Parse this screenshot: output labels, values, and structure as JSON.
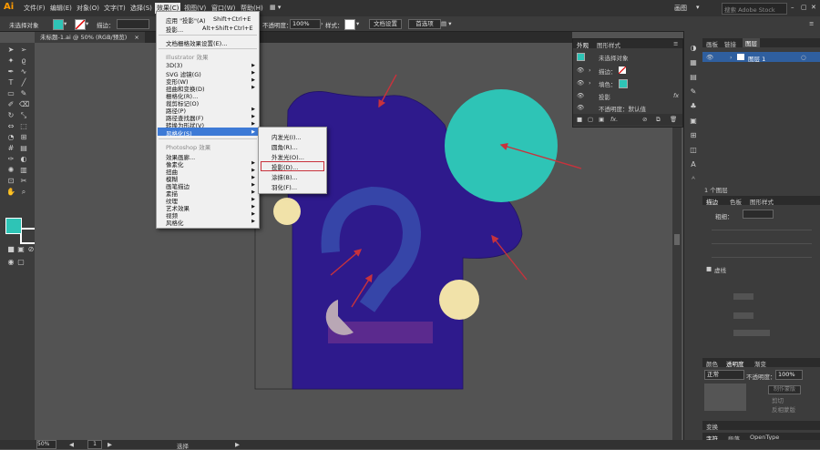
{
  "menubar": {
    "logo": "Ai",
    "items": [
      "文件(F)",
      "编辑(E)",
      "对象(O)",
      "文字(T)",
      "选择(S)",
      "效果(C)",
      "视图(V)",
      "窗口(W)",
      "帮助(H)"
    ],
    "active_index": 5,
    "workspace": "画图",
    "search_placeholder": "搜索 Adobe Stock"
  },
  "control_bar": {
    "selection": "未选择对象",
    "stroke_label": "描边：",
    "opacity_label": "不透明度：",
    "opacity_value": "100%",
    "style_label": "样式：",
    "doc_setup": "文档设置",
    "prefs": "首选项"
  },
  "document_tab": {
    "label": "未标题-1.ai @ 50% (RGB/预览)",
    "close": "×"
  },
  "effect_menu": {
    "items": [
      {
        "label": "应用 \"投影\"(A)",
        "shortcut": "Shift+Ctrl+E"
      },
      {
        "label": "投影...",
        "shortcut": "Alt+Shift+Ctrl+E"
      },
      {
        "label": "文档栅格效果设置(E)..."
      }
    ],
    "illustrator_header": "Illustrator 效果",
    "illustrator_items": [
      "3D(3)",
      "SVG 滤镜(G)",
      "变形(W)",
      "扭曲和变换(D)",
      "栅格化(R)...",
      "裁剪标记(O)",
      "路径(P)",
      "路径查找器(F)",
      "转换为形状(V)",
      "风格化(S)"
    ],
    "highlighted_index": 9,
    "photoshop_header": "Photoshop 效果",
    "photoshop_items": [
      "效果画廊...",
      "像素化",
      "扭曲",
      "模糊",
      "画笔描边",
      "素描",
      "纹理",
      "艺术效果",
      "视频",
      "风格化"
    ]
  },
  "stylize_submenu": {
    "items": [
      "内发光(I)...",
      "圆角(R)...",
      "外发光(O)...",
      "投影(D)...",
      "涂抹(B)...",
      "羽化(F)..."
    ],
    "boxed_index": 3
  },
  "appearance_panel": {
    "tabs": [
      "外观",
      "图形样式"
    ],
    "title": "未选择对象",
    "rows": [
      {
        "label": "描边："
      },
      {
        "label": "填色："
      },
      {
        "label": "投影",
        "fx": "fx"
      },
      {
        "label": "不透明度：默认值"
      }
    ],
    "footer_fx": "fx."
  },
  "layers_panel": {
    "tabs": [
      "画板",
      "链接",
      "图层"
    ],
    "active_tab": 2,
    "layer_name": "图层 1",
    "count": "1 个图层"
  },
  "stroke_panel": {
    "tabs": [
      "描边",
      "色板",
      "图形样式"
    ],
    "weight_label": "粗细：",
    "dashed_label": "虚线"
  },
  "transparency_panel": {
    "tabs": [
      "颜色",
      "透明度",
      "渐变"
    ],
    "mode": "正常",
    "opacity_label": "不透明度：",
    "opacity_value": "100%",
    "make_mask": "制作蒙版",
    "clip": "剪切",
    "invert": "反相蒙版"
  },
  "bottom_panels": {
    "transform": "变换",
    "tabs": [
      "字符",
      "段落",
      "OpenType"
    ]
  },
  "status_bar": {
    "zoom": "50%",
    "page": "1",
    "tool": "选择"
  },
  "colors": {
    "purple": "#2e1a8c",
    "teal": "#2ec4b6",
    "cream": "#f1e2a9",
    "blue": "#3645a8",
    "lavender": "#b9a7b5",
    "magenta": "#5b2a8e",
    "arrow": "#c8323c",
    "menu_highlight": "#3d7ad6"
  }
}
